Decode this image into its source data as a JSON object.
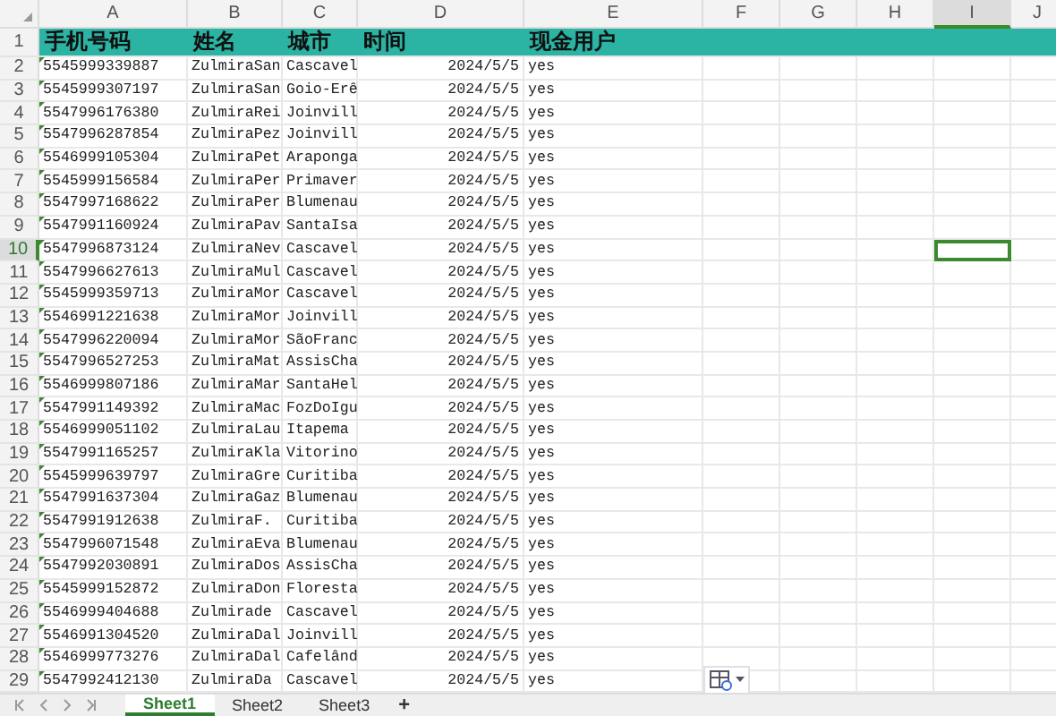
{
  "columns": [
    {
      "label": "A",
      "selected": false
    },
    {
      "label": "B",
      "selected": false
    },
    {
      "label": "C",
      "selected": false
    },
    {
      "label": "D",
      "selected": false
    },
    {
      "label": "E",
      "selected": false
    },
    {
      "label": "F",
      "selected": false
    },
    {
      "label": "G",
      "selected": false
    },
    {
      "label": "H",
      "selected": false
    },
    {
      "label": "I",
      "selected": true
    },
    {
      "label": "J",
      "selected": false
    }
  ],
  "header_row": {
    "number": "1",
    "selected": false,
    "cells": [
      "手机号码",
      "姓名",
      "城市",
      "时间",
      "现金用户"
    ]
  },
  "rows": [
    {
      "number": "2",
      "selected": false,
      "cells": [
        "5545999339887",
        "ZulmiraSan",
        "Cascavel",
        "2024/5/5",
        "yes"
      ]
    },
    {
      "number": "3",
      "selected": false,
      "cells": [
        "5545999307197",
        "ZulmiraSan",
        "Goio-Erê",
        "2024/5/5",
        "yes"
      ]
    },
    {
      "number": "4",
      "selected": false,
      "cells": [
        "5547996176380",
        "ZulmiraRei",
        "Joinvill",
        "2024/5/5",
        "yes"
      ]
    },
    {
      "number": "5",
      "selected": false,
      "cells": [
        "5547996287854",
        "ZulmiraPez",
        "Joinvill",
        "2024/5/5",
        "yes"
      ]
    },
    {
      "number": "6",
      "selected": false,
      "cells": [
        "5546999105304",
        "ZulmiraPet",
        "Araponga",
        "2024/5/5",
        "yes"
      ]
    },
    {
      "number": "7",
      "selected": false,
      "cells": [
        "5545999156584",
        "ZulmiraPer",
        "Primaver",
        "2024/5/5",
        "yes"
      ]
    },
    {
      "number": "8",
      "selected": false,
      "cells": [
        "5547997168622",
        "ZulmiraPer",
        "Blumenau",
        "2024/5/5",
        "yes"
      ]
    },
    {
      "number": "9",
      "selected": false,
      "cells": [
        "5547991160924",
        "ZulmiraPav",
        "SantaIsa",
        "2024/5/5",
        "yes"
      ]
    },
    {
      "number": "10",
      "selected": true,
      "cells": [
        "5547996873124",
        "ZulmiraNev",
        "Cascavel",
        "2024/5/5",
        "yes"
      ]
    },
    {
      "number": "11",
      "selected": false,
      "cells": [
        "5547996627613",
        "ZulmiraMul",
        "Cascavel",
        "2024/5/5",
        "yes"
      ]
    },
    {
      "number": "12",
      "selected": false,
      "cells": [
        "5545999359713",
        "ZulmiraMor",
        "Cascavel",
        "2024/5/5",
        "yes"
      ]
    },
    {
      "number": "13",
      "selected": false,
      "cells": [
        "5546991221638",
        "ZulmiraMor",
        "Joinvill",
        "2024/5/5",
        "yes"
      ]
    },
    {
      "number": "14",
      "selected": false,
      "cells": [
        "5547996220094",
        "ZulmiraMor",
        "SãoFranc",
        "2024/5/5",
        "yes"
      ]
    },
    {
      "number": "15",
      "selected": false,
      "cells": [
        "5547996527253",
        "ZulmiraMat",
        "AssisCha",
        "2024/5/5",
        "yes"
      ]
    },
    {
      "number": "16",
      "selected": false,
      "cells": [
        "5546999807186",
        "ZulmiraMar",
        "SantaHel",
        "2024/5/5",
        "yes"
      ]
    },
    {
      "number": "17",
      "selected": false,
      "cells": [
        "5547991149392",
        "ZulmiraMac",
        "FozDoIgu",
        "2024/5/5",
        "yes"
      ]
    },
    {
      "number": "18",
      "selected": false,
      "cells": [
        "5546999051102",
        "ZulmiraLau",
        "Itapema",
        "2024/5/5",
        "yes"
      ]
    },
    {
      "number": "19",
      "selected": false,
      "cells": [
        "5547991165257",
        "ZulmiraKla",
        "Vitorino",
        "2024/5/5",
        "yes"
      ]
    },
    {
      "number": "20",
      "selected": false,
      "cells": [
        "5545999639797",
        "ZulmiraGre",
        "Curitiba",
        "2024/5/5",
        "yes"
      ]
    },
    {
      "number": "21",
      "selected": false,
      "cells": [
        "5547991637304",
        "ZulmiraGaz",
        "Blumenau",
        "2024/5/5",
        "yes"
      ]
    },
    {
      "number": "22",
      "selected": false,
      "cells": [
        "5547991912638",
        "ZulmiraF.",
        "Curitiba",
        "2024/5/5",
        "yes"
      ]
    },
    {
      "number": "23",
      "selected": false,
      "cells": [
        "5547996071548",
        "ZulmiraEva",
        "Blumenau",
        "2024/5/5",
        "yes"
      ]
    },
    {
      "number": "24",
      "selected": false,
      "cells": [
        "5547992030891",
        "ZulmiraDos",
        "AssisCha",
        "2024/5/5",
        "yes"
      ]
    },
    {
      "number": "25",
      "selected": false,
      "cells": [
        "5545999152872",
        "ZulmiraDon",
        "Floresta",
        "2024/5/5",
        "yes"
      ]
    },
    {
      "number": "26",
      "selected": false,
      "cells": [
        "5546999404688",
        "Zulmirade",
        "Cascavel",
        "2024/5/5",
        "yes"
      ]
    },
    {
      "number": "27",
      "selected": false,
      "cells": [
        "5546991304520",
        "ZulmiraDal",
        "Joinvill",
        "2024/5/5",
        "yes"
      ]
    },
    {
      "number": "28",
      "selected": false,
      "cells": [
        "5546999773276",
        "ZulmiraDal",
        "Cafelând",
        "2024/5/5",
        "yes"
      ]
    },
    {
      "number": "29",
      "selected": false,
      "cells": [
        "5547992412130",
        "ZulmiraDa",
        "Cascavel",
        "2024/5/5",
        "yes"
      ]
    }
  ],
  "sheets": [
    {
      "label": "Sheet1",
      "selected": true
    },
    {
      "label": "Sheet2",
      "selected": false
    },
    {
      "label": "Sheet3",
      "selected": false
    }
  ],
  "add_sheet": "+"
}
